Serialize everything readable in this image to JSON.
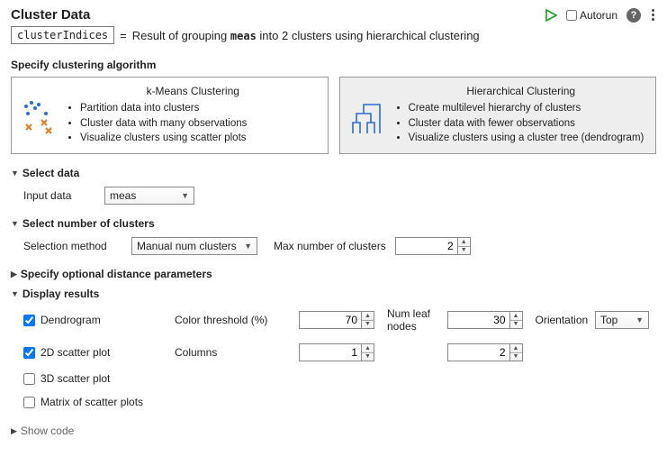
{
  "header": {
    "title": "Cluster Data",
    "autorun_label": "Autorun",
    "autorun_checked": false
  },
  "result": {
    "var_name": "clusterIndices",
    "equals": "=",
    "prefix": "Result of grouping",
    "data_name": "meas",
    "suffix": "into 2 clusters using hierarchical clustering"
  },
  "algo": {
    "section_title": "Specify clustering algorithm",
    "kmeans": {
      "title": "k-Means Clustering",
      "b1": "Partition data into clusters",
      "b2": "Cluster data with many observations",
      "b3": "Visualize clusters using scatter plots"
    },
    "hier": {
      "title": "Hierarchical Clustering",
      "b1": "Create multilevel hierarchy of clusters",
      "b2": "Cluster data with fewer observations",
      "b3": "Visualize clusters using a cluster tree (dendrogram)"
    }
  },
  "select_data": {
    "heading": "Select data",
    "input_label": "Input data",
    "input_value": "meas"
  },
  "clusters": {
    "heading": "Select number of clusters",
    "method_label": "Selection method",
    "method_value": "Manual num clusters",
    "max_label": "Max number of clusters",
    "max_value": "2"
  },
  "distance": {
    "heading": "Specify optional distance parameters"
  },
  "display": {
    "heading": "Display results",
    "dendrogram": {
      "label": "Dendrogram",
      "checked": true
    },
    "color_thresh": {
      "label": "Color threshold (%)",
      "value": "70"
    },
    "leaf": {
      "label": "Num leaf nodes",
      "value": "30"
    },
    "orientation": {
      "label": "Orientation",
      "value": "Top"
    },
    "scatter2d": {
      "label": "2D scatter plot",
      "checked": true
    },
    "columns_label": "Columns",
    "col1": "1",
    "col2": "2",
    "scatter3d": {
      "label": "3D scatter plot",
      "checked": false
    },
    "matrix": {
      "label": "Matrix of scatter plots",
      "checked": false
    }
  },
  "showcode": "Show code"
}
